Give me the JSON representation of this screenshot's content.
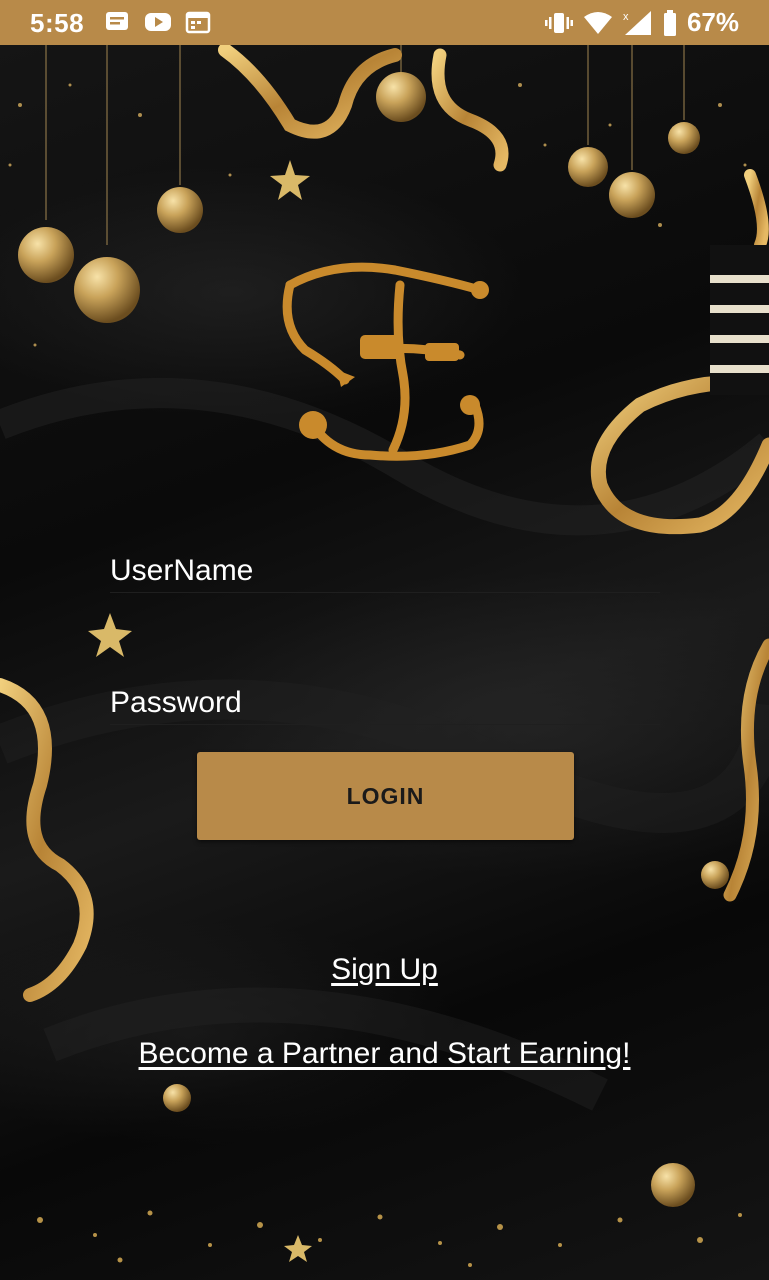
{
  "status_bar": {
    "time": "5:58",
    "battery": "67%",
    "left_icons": [
      "message-icon",
      "youtube-icon",
      "calendar-icon"
    ],
    "right_icons": [
      "vibrate-icon",
      "wifi-icon",
      "signal-icon",
      "battery-icon"
    ],
    "background_color": "#b88a49"
  },
  "login_form": {
    "username_placeholder": "UserName",
    "password_placeholder": "Password",
    "login_label": "LOGIN",
    "accent_color": "#b88a49"
  },
  "links": {
    "sign_up": "Sign Up",
    "partner": "Become a Partner and Start Earning!"
  },
  "logo": {
    "icon": "ornate-monogram-logo",
    "color": "#c98a2c"
  }
}
